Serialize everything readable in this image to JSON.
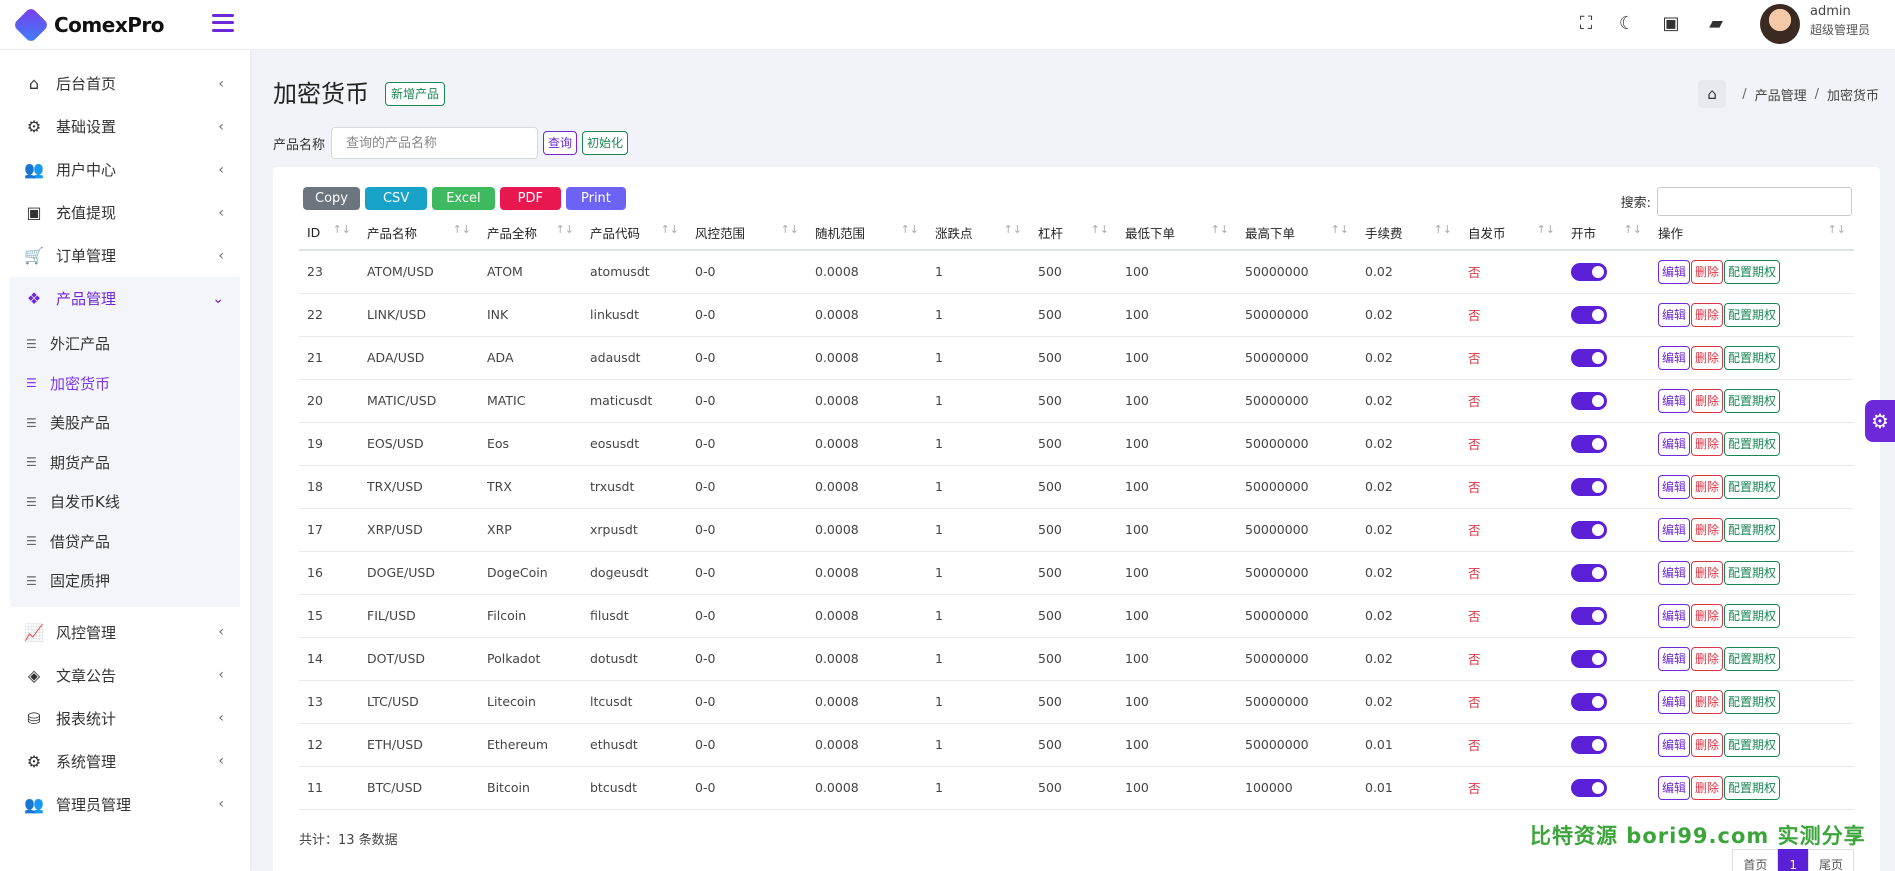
{
  "brand": {
    "name": "ComexPro",
    "accent": "#6d28d9"
  },
  "topbar": {
    "icons": [
      "fullscreen-icon",
      "moon-icon",
      "money-icon",
      "message-icon"
    ],
    "user_name": "admin",
    "user_role": "超级管理员"
  },
  "sidebar": {
    "items": [
      {
        "label": "后台首页",
        "icon": "home-icon"
      },
      {
        "label": "基础设置",
        "icon": "gears-icon"
      },
      {
        "label": "用户中心",
        "icon": "users-icon"
      },
      {
        "label": "充值提现",
        "icon": "money-icon"
      },
      {
        "label": "订单管理",
        "icon": "cart-icon"
      },
      {
        "label": "产品管理",
        "icon": "cubes-icon"
      },
      {
        "label": "风控管理",
        "icon": "chart-line-icon"
      },
      {
        "label": "文章公告",
        "icon": "layers-icon"
      },
      {
        "label": "报表统计",
        "icon": "database-icon"
      },
      {
        "label": "系统管理",
        "icon": "gear-icon"
      },
      {
        "label": "管理员管理",
        "icon": "user-group-icon"
      }
    ],
    "submenu": [
      "外汇产品",
      "加密货币",
      "美股产品",
      "期货产品",
      "自发币K线",
      "借贷产品",
      "固定质押"
    ]
  },
  "page": {
    "title": "加密货币",
    "new_button": "新增产品",
    "breadcrumb": [
      "产品管理",
      "加密货币"
    ],
    "filter_label": "产品名称",
    "filter_placeholder": "查询的产品名称",
    "query_button": "查询",
    "init_button": "初始化",
    "search_label": "搜索:"
  },
  "export_buttons": [
    {
      "label": "Copy",
      "color": "#6c757d"
    },
    {
      "label": "CSV",
      "color": "#17a2c8"
    },
    {
      "label": "Excel",
      "color": "#3fb95f"
    },
    {
      "label": "PDF",
      "color": "#e8174f"
    },
    {
      "label": "Print",
      "color": "#6c63f5"
    }
  ],
  "table": {
    "columns": [
      "ID",
      "产品名称",
      "产品全称",
      "产品代码",
      "风控范围",
      "随机范围",
      "涨跌点",
      "杠杆",
      "最低下单",
      "最高下单",
      "手续费",
      "自发币",
      "开市",
      "操作"
    ],
    "rows": [
      [
        "23",
        "ATOM/USD",
        "ATOM",
        "atomusdt",
        "0-0",
        "0.0008",
        "1",
        "500",
        "100",
        "50000000",
        "0.02",
        "否"
      ],
      [
        "22",
        "LINK/USD",
        "INK",
        "linkusdt",
        "0-0",
        "0.0008",
        "1",
        "500",
        "100",
        "50000000",
        "0.02",
        "否"
      ],
      [
        "21",
        "ADA/USD",
        "ADA",
        "adausdt",
        "0-0",
        "0.0008",
        "1",
        "500",
        "100",
        "50000000",
        "0.02",
        "否"
      ],
      [
        "20",
        "MATIC/USD",
        "MATIC",
        "maticusdt",
        "0-0",
        "0.0008",
        "1",
        "500",
        "100",
        "50000000",
        "0.02",
        "否"
      ],
      [
        "19",
        "EOS/USD",
        "Eos",
        "eosusdt",
        "0-0",
        "0.0008",
        "1",
        "500",
        "100",
        "50000000",
        "0.02",
        "否"
      ],
      [
        "18",
        "TRX/USD",
        "TRX",
        "trxusdt",
        "0-0",
        "0.0008",
        "1",
        "500",
        "100",
        "50000000",
        "0.02",
        "否"
      ],
      [
        "17",
        "XRP/USD",
        "XRP",
        "xrpusdt",
        "0-0",
        "0.0008",
        "1",
        "500",
        "100",
        "50000000",
        "0.02",
        "否"
      ],
      [
        "16",
        "DOGE/USD",
        "DogeCoin",
        "dogeusdt",
        "0-0",
        "0.0008",
        "1",
        "500",
        "100",
        "50000000",
        "0.02",
        "否"
      ],
      [
        "15",
        "FIL/USD",
        "Filcoin",
        "filusdt",
        "0-0",
        "0.0008",
        "1",
        "500",
        "100",
        "50000000",
        "0.02",
        "否"
      ],
      [
        "14",
        "DOT/USD",
        "Polkadot",
        "dotusdt",
        "0-0",
        "0.0008",
        "1",
        "500",
        "100",
        "50000000",
        "0.02",
        "否"
      ],
      [
        "13",
        "LTC/USD",
        "Litecoin",
        "ltcusdt",
        "0-0",
        "0.0008",
        "1",
        "500",
        "100",
        "50000000",
        "0.02",
        "否"
      ],
      [
        "12",
        "ETH/USD",
        "Ethereum",
        "ethusdt",
        "0-0",
        "0.0008",
        "1",
        "500",
        "100",
        "50000000",
        "0.01",
        "否"
      ],
      [
        "11",
        "BTC/USD",
        "Bitcoin",
        "btcusdt",
        "0-0",
        "0.0008",
        "1",
        "500",
        "100",
        "100000",
        "0.01",
        "否"
      ]
    ],
    "actions": [
      "编辑",
      "删除",
      "配置期权"
    ],
    "market_open": true
  },
  "footer": {
    "total": "共计：13 条数据",
    "pager": [
      "首页",
      "1",
      "尾页"
    ]
  },
  "watermark": "比特资源 bori99.com 实测分享"
}
